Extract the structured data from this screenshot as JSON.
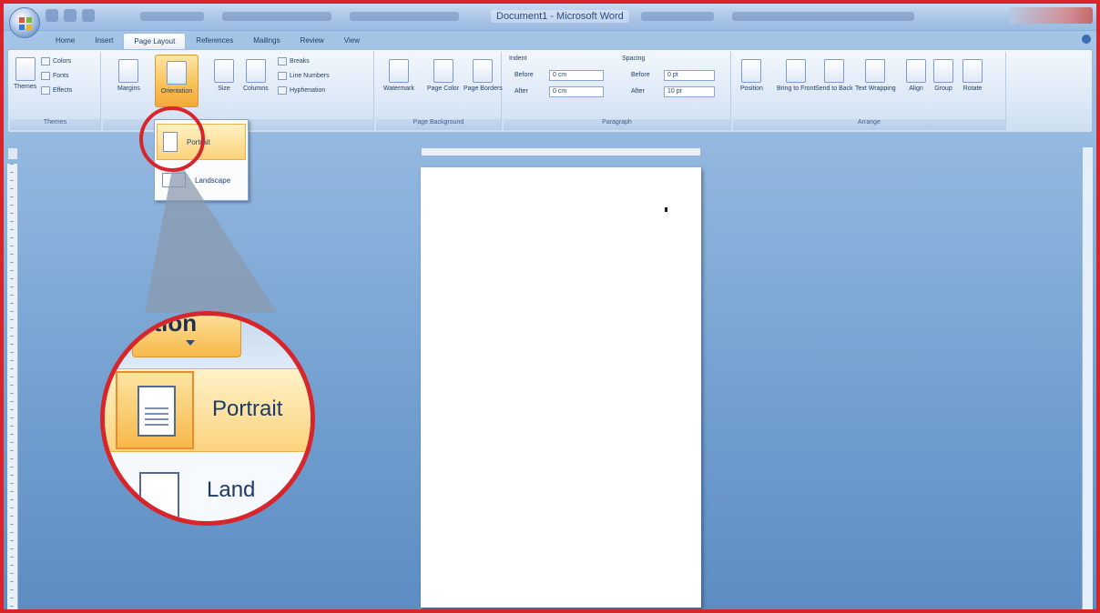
{
  "window": {
    "title": "Document1 - Microsoft Word"
  },
  "tabs": [
    {
      "label": "Home",
      "active": false
    },
    {
      "label": "Insert",
      "active": false
    },
    {
      "label": "Page Layout",
      "active": true
    },
    {
      "label": "References",
      "active": false
    },
    {
      "label": "Mailings",
      "active": false
    },
    {
      "label": "Review",
      "active": false
    },
    {
      "label": "View",
      "active": false
    }
  ],
  "ribbon": {
    "themes": {
      "themes_label": "Themes",
      "colors_label": "Colors",
      "fonts_label": "Fonts",
      "effects_label": "Effects",
      "group_label": "Themes"
    },
    "page_setup": {
      "margins_label": "Margins",
      "orientation_label": "Orientation",
      "size_label": "Size",
      "columns_label": "Columns",
      "breaks_label": "Breaks",
      "line_numbers_label": "Line Numbers",
      "hyphenation_label": "Hyphenation"
    },
    "page_background": {
      "watermark_label": "Watermark",
      "page_color_label": "Page Color",
      "page_borders_label": "Page Borders",
      "group_label": "Page Background"
    },
    "paragraph": {
      "indent_label": "Indent",
      "spacing_label": "Spacing",
      "indent_left_label": "Before",
      "indent_left_value": "0 cm",
      "indent_right_label": "After",
      "indent_right_value": "0 cm",
      "spacing_before_label": "Before",
      "spacing_before_value": "0 pt",
      "spacing_after_label": "After",
      "spacing_after_value": "10 pt",
      "group_label": "Paragraph"
    },
    "arrange": {
      "position_label": "Position",
      "bring_front_label": "Bring to Front",
      "send_back_label": "Send to Back",
      "text_wrapping_label": "Text Wrapping",
      "align_label": "Align",
      "group_btn_label": "Group",
      "rotate_label": "Rotate",
      "group_label": "Arrange"
    }
  },
  "orientation_menu": {
    "items": [
      {
        "label": "Portrait",
        "selected": true
      },
      {
        "label": "Landscape",
        "selected": false
      }
    ]
  },
  "zoom": {
    "orientation_fragment": "ation",
    "portrait_label": "Portrait",
    "landscape_fragment": "Land"
  },
  "colors": {
    "highlight": "#d7262b",
    "selected_item": "#fcd27a",
    "ribbon": "#dfeaf7"
  }
}
